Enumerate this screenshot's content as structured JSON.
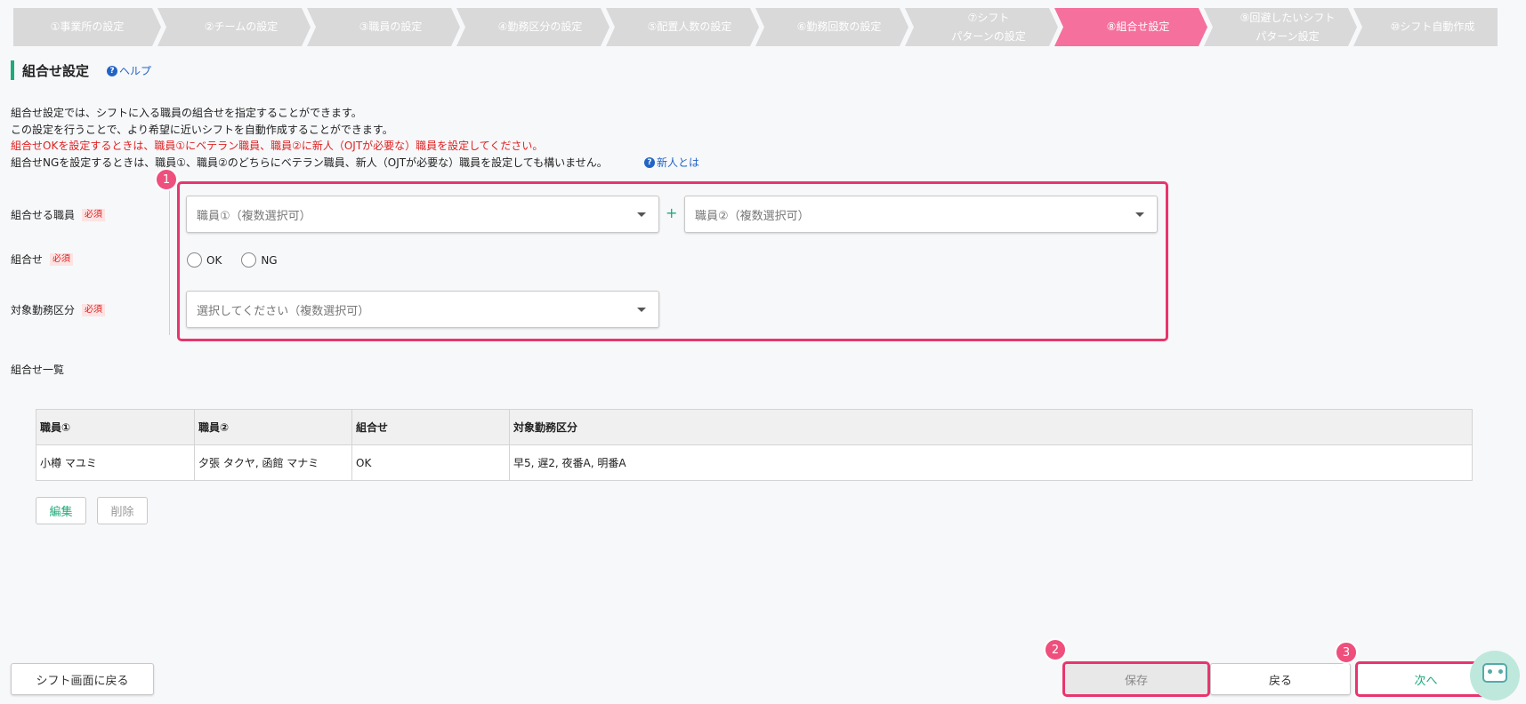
{
  "steps": [
    {
      "label": "①事業所の設定",
      "active": false
    },
    {
      "label": "②チームの設定",
      "active": false
    },
    {
      "label": "③職員の設定",
      "active": false
    },
    {
      "label": "④勤務区分の設定",
      "active": false
    },
    {
      "label": "⑤配置人数の設定",
      "active": false
    },
    {
      "label": "⑥勤務回数の設定",
      "active": false
    },
    {
      "label": "⑦シフト\nパターンの設定",
      "active": false
    },
    {
      "label": "⑧組合せ設定",
      "active": true
    },
    {
      "label": "⑨回避したいシフト\nパターン設定",
      "active": false
    },
    {
      "label": "⑩シフト自動作成",
      "active": false
    }
  ],
  "header": {
    "title": "組合せ設定",
    "help": "ヘルプ",
    "help_icon": "question-icon"
  },
  "description": {
    "line1": "組合せ設定では、シフトに入る職員の組合せを指定することができます。",
    "line2": "この設定を行うことで、より希望に近いシフトを自動作成することができます。",
    "line3": "組合せOKを設定するときは、職員①にベテラン職員、職員②に新人（OJTが必要な）職員を設定してください。",
    "line4": "組合せNGを設定するときは、職員①、職員②のどちらにベテラン職員、新人（OJTが必要な）職員を設定しても構いません。",
    "newbie_link": "新人とは"
  },
  "form": {
    "staff_label": "組合せる職員",
    "combo_label": "組合せ",
    "target_label": "対象勤務区分",
    "required": "必須",
    "staff1_placeholder": "職員①（複数選択可）",
    "staff2_placeholder": "職員②（複数選択可）",
    "plus": "+",
    "ok": "OK",
    "ng": "NG",
    "target_placeholder": "選択してください（複数選択可）"
  },
  "list": {
    "title": "組合せ一覧",
    "columns": [
      "職員①",
      "職員②",
      "組合せ",
      "対象勤務区分"
    ],
    "rows": [
      [
        "小樽 マユミ",
        "夕張 タクヤ, 函館 マナミ",
        "OK",
        "早5, 遅2, 夜番A, 明番A"
      ]
    ],
    "edit": "編集",
    "delete": "削除"
  },
  "footer": {
    "back_to_shift": "シフト画面に戻る",
    "save": "保存",
    "return": "戻る",
    "next": "次へ"
  },
  "badges": [
    "1",
    "2",
    "3"
  ],
  "colors": {
    "accent": "#1faa7a",
    "active_step": "#f5709c",
    "highlight": "#e8356d",
    "required": "#e02020",
    "link": "#2264c4"
  }
}
